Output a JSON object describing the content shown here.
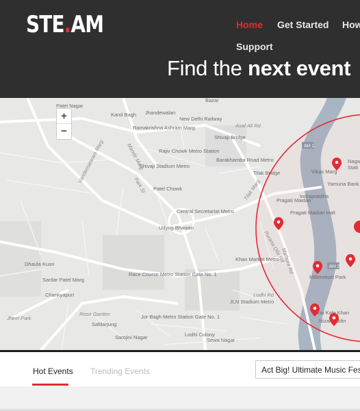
{
  "header": {
    "logo_left": "STE",
    "logo_dot": ".",
    "logo_right": "AM",
    "hero_light": "Find the ",
    "hero_bold": "next event"
  },
  "nav": {
    "items": [
      {
        "label": "Home",
        "active": true
      },
      {
        "label": "Get Started",
        "active": false
      },
      {
        "label": "How",
        "active": false
      },
      {
        "label": "Support",
        "active": false
      }
    ]
  },
  "map": {
    "zoom_in": "+",
    "zoom_out": "−",
    "labels": [
      "Patel Nagar",
      "Karol Bagh",
      "Jhandewalan",
      "New Delhi Railway",
      "Ramakrishna Ashram Marg",
      "Shivaji Bridge",
      "Rajiv Chowk Metro Station",
      "Barakhamba Road Metro",
      "Shivaji Stadium Metro",
      "Patel Chowk",
      "Central Secretariat Metro",
      "Udyog Bhawan",
      "Race Course Metro Station Gate No. 1",
      "Dhaula Kuan",
      "Sardar Patel Marg",
      "Chankyapuri",
      "Rose Garden",
      "Safdarjung",
      "Jor Bagh Metro Station Gate No. 1",
      "JLN Stadium Metro",
      "Lodhi Colony",
      "Sewa Nagar",
      "Sarojini Nagar",
      "Khan Market Metro",
      "Lodhi Rd",
      "Tilak Bridge",
      "Pragati Maidan",
      "Pragati Maidan Halt",
      "Indraprastha",
      "Millennium Park",
      "Sarai Kale Khan",
      "Yamuna Bank",
      "Vikas Marg",
      "Nagar",
      "Stati",
      "Jheel Park",
      "Bazar",
      "Asaf Ali Rd",
      "Mandir Marg",
      "Vandemataram Marg",
      "Park St",
      "Tilak Marg",
      "Purana Qila Rd",
      "Mathura Rd",
      "Nizamuddin",
      "AH 1",
      "AH 2"
    ]
  },
  "tabs": {
    "hot": "Hot Events",
    "trending": "Trending Events",
    "event_select": "Act Big! Ultimate Music Festival"
  },
  "colors": {
    "accent": "#e22b33",
    "header_bg": "#2f2f2f",
    "river": "#a8b5c3"
  }
}
